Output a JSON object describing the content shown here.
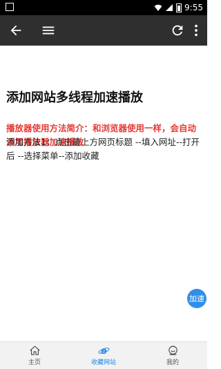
{
  "status_bar": {
    "time": "9:55",
    "icons": [
      "app-icon",
      "wifi-icon",
      "signal-icon",
      "battery-icon"
    ]
  },
  "toolbar": {
    "icons": [
      "back-arrow-icon",
      "menu-icon",
      "refresh-icon",
      "more-vert-icon"
    ],
    "background": "#2f2f2f"
  },
  "content": {
    "title": "添加网站多线程加速播放",
    "intro": "播放器使用方法简介：和浏览器使用一样，会自动调用播放器加速播放",
    "method": "添加方法1：点击最上方网页标题 --填入网址--打开后 --选择菜单--添加收藏",
    "intro_color": "#e53935"
  },
  "fab": {
    "label": "加速",
    "color": "#2f8fe6"
  },
  "bottom_nav": {
    "items": [
      {
        "label": "主页",
        "icon": "home-icon",
        "active": false
      },
      {
        "label": "收藏网站",
        "icon": "browser-e-icon",
        "active": true
      },
      {
        "label": "我的",
        "icon": "profile-icon",
        "active": false
      }
    ],
    "active_color": "#1e88e5"
  }
}
